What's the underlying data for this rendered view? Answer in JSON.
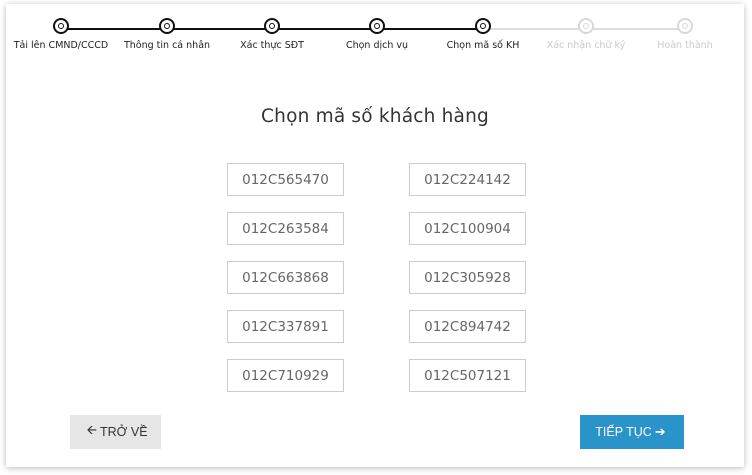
{
  "stepper": {
    "steps": [
      {
        "label": "Tải lên CMND/CCCD",
        "active": true
      },
      {
        "label": "Thông tin cá nhân",
        "active": true
      },
      {
        "label": "Xác thực SĐT",
        "active": true
      },
      {
        "label": "Chọn dịch vụ",
        "active": true
      },
      {
        "label": "Chọn mã số KH",
        "active": true
      },
      {
        "label": "Xác nhận chữ ký",
        "active": false
      },
      {
        "label": "Hoàn thành",
        "active": false
      }
    ]
  },
  "page_title": "Chọn mã số khách hàng",
  "codes": {
    "left": [
      "012C565470",
      "012C263584",
      "012C663868",
      "012C337891",
      "012C710929"
    ],
    "right": [
      "012C224142",
      "012C100904",
      "012C305928",
      "012C894742",
      "012C507121"
    ]
  },
  "actions": {
    "back_label": "TRỞ VỀ",
    "next_label": "TIẾP TỤC"
  },
  "colors": {
    "primary": "#2a93c9",
    "step_active": "#111111",
    "step_inactive": "#d8d8d8"
  }
}
